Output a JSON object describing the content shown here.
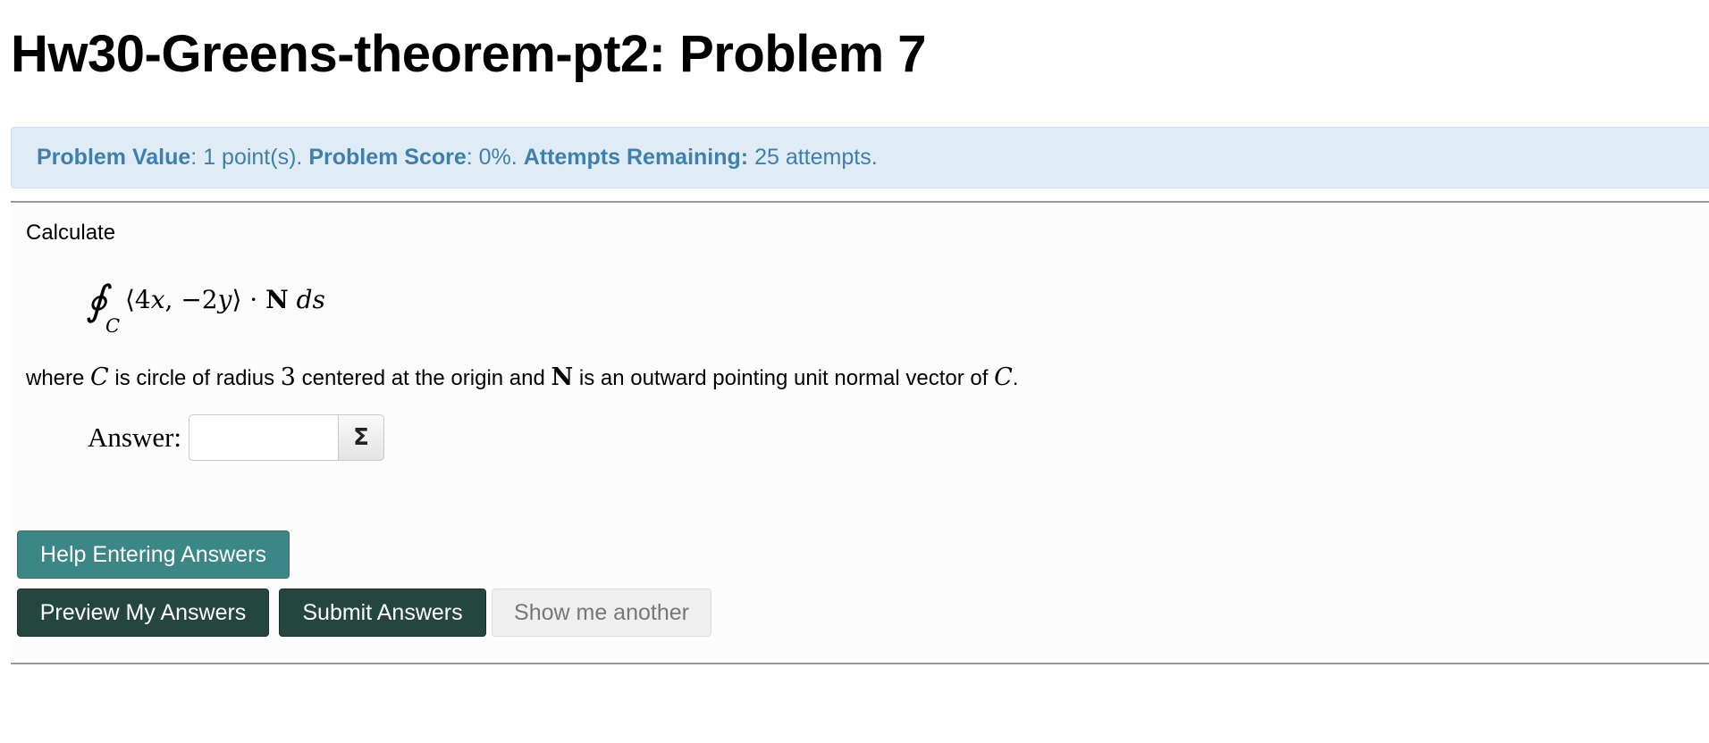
{
  "page": {
    "title": "Hw30-Greens-theorem-pt2: Problem 7"
  },
  "info": {
    "value_label": "Problem Value",
    "value_text": ": 1 point(s).",
    "score_label": "Problem Score",
    "score_text": ": 0%.",
    "attempts_label": "Attempts Remaining:",
    "attempts_text": "25 attempts."
  },
  "problem": {
    "intro": "Calculate",
    "formula": {
      "integral_symbol": "∮",
      "subscript": "C",
      "open": "⟨4",
      "x": "x",
      "mid": ", −2",
      "y": "y",
      "close": "⟩ · ",
      "N": "N",
      "ds": " ds"
    },
    "sentence": {
      "p1": "where ",
      "C1": "C",
      "p2": " is circle of radius ",
      "radius": "3",
      "p3": " centered at the origin and ",
      "N": "N",
      "p4": " is an outward pointing unit normal vector of ",
      "C2": "C",
      "p5": "."
    },
    "answer_label": "Answer:",
    "answer_value": "",
    "sigma_label": "Σ"
  },
  "buttons": {
    "help": "Help Entering Answers",
    "preview": "Preview My Answers",
    "submit": "Submit Answers",
    "another": "Show me another"
  },
  "colors": {
    "info_bg": "#dfecf6",
    "info_text": "#3e7fae",
    "help_button": "#3b8787",
    "dark_button": "#24463e",
    "disabled_button": "#efefef"
  }
}
